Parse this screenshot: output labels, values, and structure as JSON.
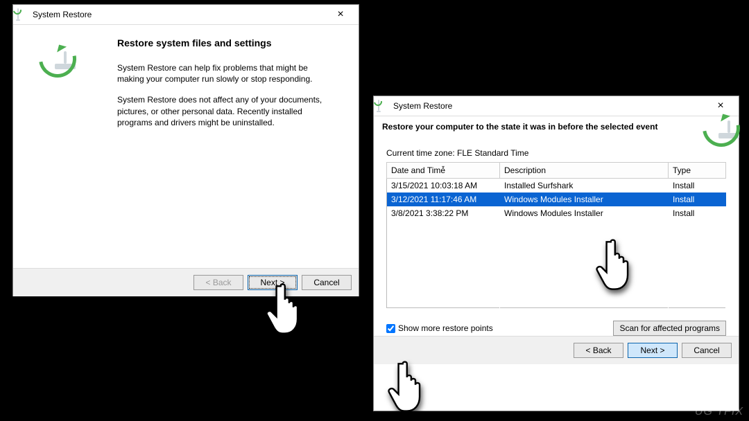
{
  "win1": {
    "title": "System Restore",
    "heading": "Restore system files and settings",
    "para1": "System Restore can help fix problems that might be making your computer run slowly or stop responding.",
    "para2": "System Restore does not affect any of your documents, pictures, or other personal data. Recently installed programs and drivers might be uninstalled.",
    "buttons": {
      "back": "< Back",
      "next": "Next >",
      "cancel": "Cancel"
    }
  },
  "win2": {
    "title": "System Restore",
    "banner": "Restore your computer to the state it was in before the selected event",
    "timezone_label": "Current time zone: FLE Standard Time",
    "columns": {
      "datetime": "Date and Time",
      "description": "Description",
      "type": "Type"
    },
    "rows": [
      {
        "dt": "3/15/2021 10:03:18 AM",
        "desc": "Installed Surfshark",
        "type": "Install",
        "selected": false
      },
      {
        "dt": "3/12/2021 11:17:46 AM",
        "desc": "Windows Modules Installer",
        "type": "Install",
        "selected": true
      },
      {
        "dt": "3/8/2021 3:38:22 PM",
        "desc": "Windows Modules Installer",
        "type": "Install",
        "selected": false
      }
    ],
    "show_more_label": "Show more restore points",
    "show_more_checked": true,
    "scan_button": "Scan for affected programs",
    "buttons": {
      "back": "< Back",
      "next": "Next >",
      "cancel": "Cancel"
    }
  },
  "watermark": "UG   TFIX"
}
